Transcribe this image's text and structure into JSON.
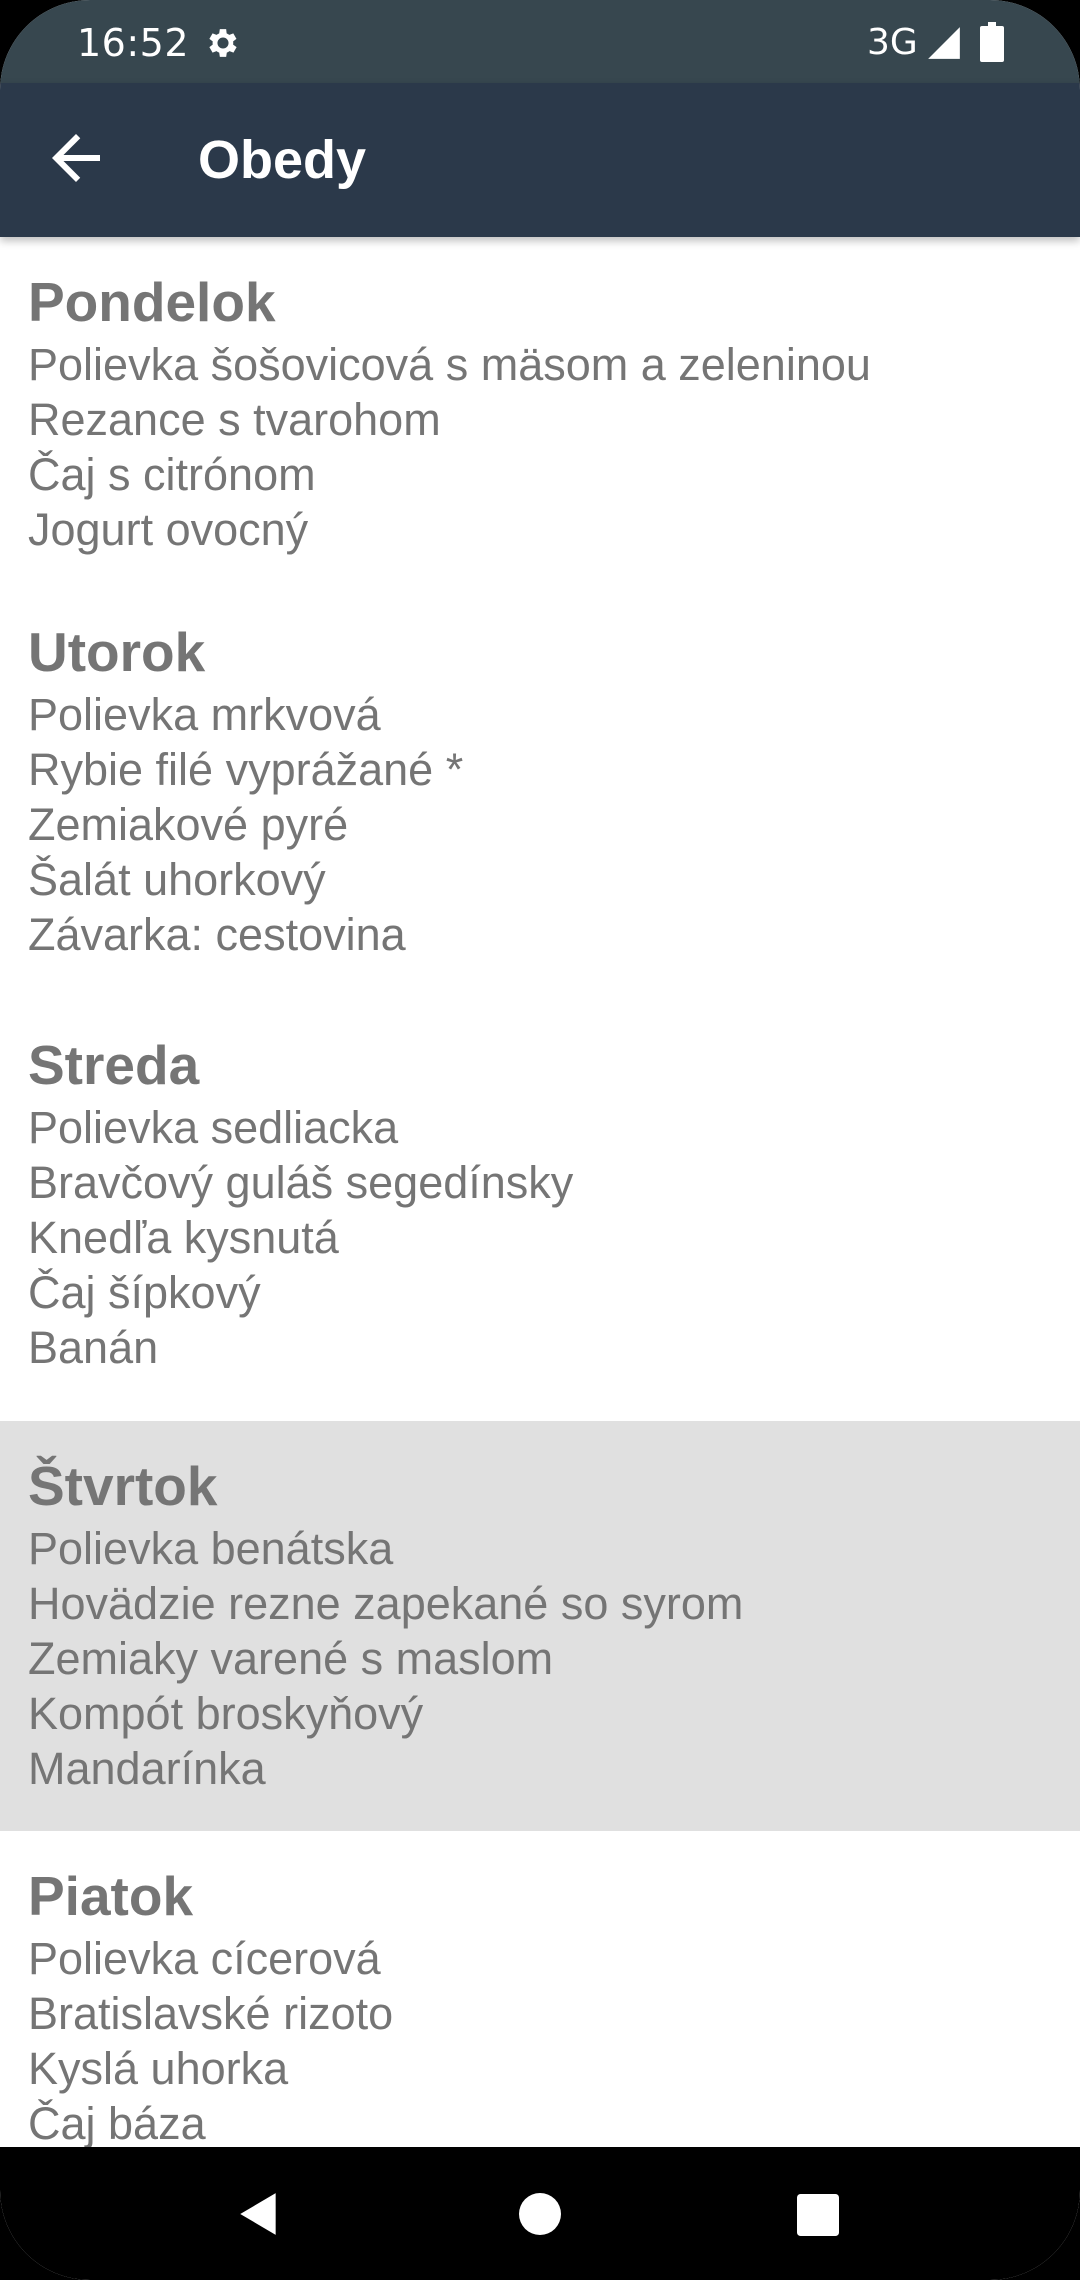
{
  "status_bar": {
    "time": "16:52",
    "network": "3G"
  },
  "app_bar": {
    "title": "Obedy"
  },
  "days": [
    {
      "name": "Pondelok",
      "items": [
        "Polievka šošovicová s mäsom a zeleninou",
        "Rezance s tvarohom",
        "Čaj s citrónom",
        "Jogurt ovocný"
      ]
    },
    {
      "name": "Utorok",
      "items": [
        "Polievka mrkvová",
        "Rybie filé vyprážané *",
        "Zemiakové pyré",
        "Šalát uhorkový",
        "Závarka: cestovina"
      ]
    },
    {
      "name": "Streda",
      "items": [
        "Polievka sedliacka",
        "Bravčový guláš segedínsky",
        "Knedľa kysnutá",
        "Čaj šípkový",
        "Banán"
      ]
    },
    {
      "name": "Štvrtok",
      "items": [
        "Polievka benátska",
        "Hovädzie rezne zapekané so syrom",
        "Zemiaky varené s maslom",
        "Kompót broskyňový",
        "Mandarínka"
      ]
    },
    {
      "name": "Piatok",
      "items": [
        "Polievka cícerová",
        "Bratislavské rizoto",
        "Kyslá uhorka",
        "Čaj báza"
      ]
    }
  ],
  "colors": {
    "status_bar": "#37474f",
    "app_bar": "#2b394a",
    "highlight_row": "#e0e0e0",
    "text": "#757575"
  }
}
